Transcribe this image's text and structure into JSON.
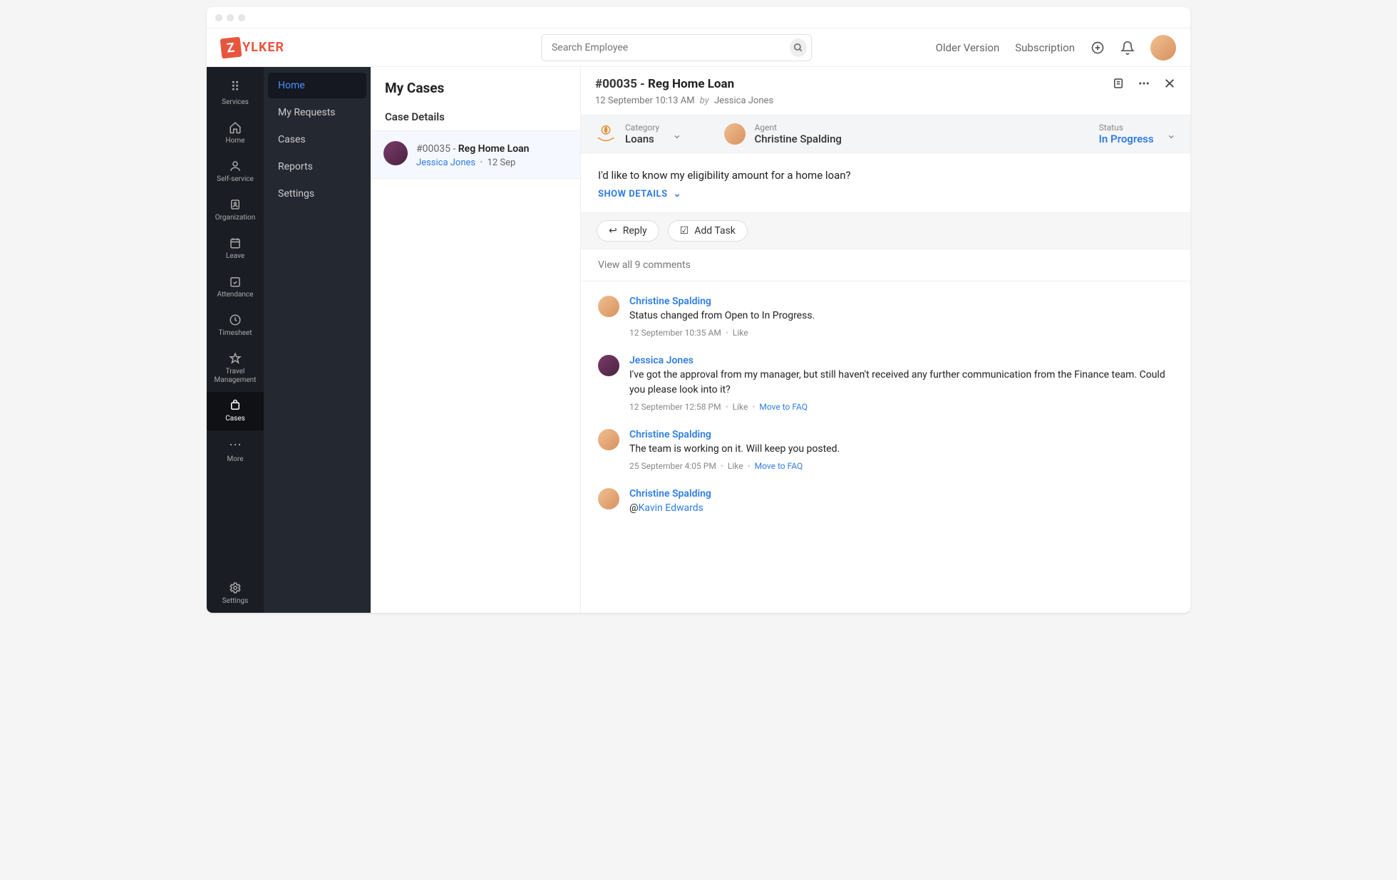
{
  "search": {
    "placeholder": "Search Employee"
  },
  "header": {
    "older": "Older Version",
    "subscription": "Subscription"
  },
  "logo": {
    "text": "YLKER",
    "badge": "Z"
  },
  "nav": [
    {
      "label": "Services"
    },
    {
      "label": "Home"
    },
    {
      "label": "Self-service"
    },
    {
      "label": "Organization"
    },
    {
      "label": "Leave"
    },
    {
      "label": "Attendance"
    },
    {
      "label": "Timesheet"
    },
    {
      "label": "Travel Management"
    },
    {
      "label": "Cases"
    },
    {
      "label": "More"
    },
    {
      "label": "Settings"
    }
  ],
  "subnav": [
    "Home",
    "My Requests",
    "Cases",
    "Reports",
    "Settings"
  ],
  "list": {
    "title": "My Cases",
    "subtitle": "Case Details",
    "case": {
      "id": "#00035 - ",
      "name": "Reg Home Loan",
      "author": "Jessica Jones",
      "date": "12 Sep"
    }
  },
  "detail": {
    "id": "#00035 - ",
    "name": "Reg Home Loan",
    "datetime": "12 September 10:13 AM",
    "by": "by",
    "author": "Jessica Jones",
    "category_label": "Category",
    "category_value": "Loans",
    "agent_label": "Agent",
    "agent_value": "Christine Spalding",
    "status_label": "Status",
    "status_value": "In Progress",
    "question": "I'd like to know my eligibility amount for a home loan?",
    "show_details": "SHOW DETAILS",
    "reply": "Reply",
    "add_task": "Add Task",
    "view_all": "View all 9 comments"
  },
  "comments": [
    {
      "author": "Christine Spalding",
      "avatar": "cs",
      "text": "Status changed from Open to In Progress.",
      "time": "12 September 10:35 AM",
      "like": "Like",
      "faq": ""
    },
    {
      "author": "Jessica Jones",
      "avatar": "jj",
      "text": "I've got the approval from my manager, but still haven't received any further communication from the Finance team. Could you please look into it?",
      "time": "12 September 12:58 PM",
      "like": "Like",
      "faq": "Move to FAQ"
    },
    {
      "author": "Christine Spalding",
      "avatar": "cs",
      "text": "The team is working on it. Will keep you posted.",
      "time": "25 September 4:05 PM",
      "like": "Like",
      "faq": "Move to FAQ"
    },
    {
      "author": "Christine Spalding",
      "avatar": "cs",
      "mention_prefix": "@",
      "mention": "Kavin Edwards",
      "time": "",
      "like": "",
      "faq": ""
    }
  ]
}
